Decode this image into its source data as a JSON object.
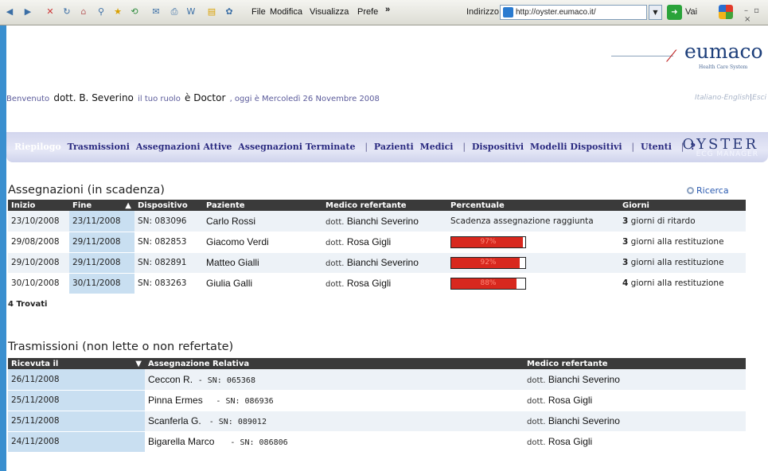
{
  "browser": {
    "menu": [
      "File",
      "Modifica",
      "Visualizza",
      "Prefe"
    ],
    "overflow": "»",
    "address_label": "Indirizzo",
    "url": "http://oyster.eumaco.it/",
    "go_label": "Vai"
  },
  "header": {
    "logo": "eumaco",
    "logo_sub": "Health Care System"
  },
  "welcome": {
    "prefix": "Benvenuto",
    "user": "dott. B. Severino",
    "role_text": "il tuo ruolo",
    "role": "è Doctor",
    "date_text": ", oggi è Mercoledì 26 Novembre 2008",
    "lang_it": "Italiano",
    "lang_sep": "-",
    "lang_en": "English",
    "pipe": "|",
    "logout": "Esci"
  },
  "nav": {
    "items": [
      "Riepilogo",
      "Trasmissioni",
      "Assegnazioni Attive",
      "Assegnazioni Terminate",
      "|",
      "Pazienti",
      "Medici",
      "|",
      "Dispositivi",
      "Modelli Dispositivi",
      "|",
      "Utenti",
      "|",
      "?"
    ],
    "brand": "OYSTER",
    "brand_sub": "ECG MANAGER"
  },
  "assegnazioni": {
    "title": "Assegnazioni (in scadenza)",
    "search": "Ricerca",
    "columns": [
      "Inizio",
      "Fine",
      "Dispositivo",
      "Paziente",
      "Medico refertante",
      "Percentuale",
      "Giorni"
    ],
    "sort_indicator": "▲",
    "rows": [
      {
        "inizio": "23/10/2008",
        "fine": "23/11/2008",
        "dispositivo": "SN: 083096",
        "paziente": "Carlo Rossi",
        "dott": "dott.",
        "medico": "Bianchi Severino",
        "percent_text": "Scadenza assegnazione raggiunta",
        "percent": null,
        "giorni_n": "3",
        "giorni": "giorni di ritardo"
      },
      {
        "inizio": "29/08/2008",
        "fine": "29/11/2008",
        "dispositivo": "SN: 082853",
        "paziente": "Giacomo Verdi",
        "dott": "dott.",
        "medico": "Rosa Gigli",
        "percent_text": "97%",
        "percent": 97,
        "giorni_n": "3",
        "giorni": "giorni alla restituzione"
      },
      {
        "inizio": "29/10/2008",
        "fine": "29/11/2008",
        "dispositivo": "SN: 082891",
        "paziente": "Matteo Gialli",
        "dott": "dott.",
        "medico": "Bianchi Severino",
        "percent_text": "92%",
        "percent": 92,
        "giorni_n": "3",
        "giorni": "giorni alla restituzione"
      },
      {
        "inizio": "30/10/2008",
        "fine": "30/11/2008",
        "dispositivo": "SN: 083263",
        "paziente": "Giulia Galli",
        "dott": "dott.",
        "medico": "Rosa Gigli",
        "percent_text": "88%",
        "percent": 88,
        "giorni_n": "4",
        "giorni": "giorni alla restituzione"
      }
    ],
    "found": "4 Trovati"
  },
  "trasmissioni": {
    "title": "Trasmissioni (non lette o non refertate)",
    "columns": [
      "Ricevuta il",
      "Assegnazione Relativa",
      "Medico refertante"
    ],
    "sort_indicator": "▼",
    "rows": [
      {
        "ricevuta": "26/11/2008",
        "paziente": "Ceccon R.",
        "sn": "- SN: 065368",
        "dott": "dott.",
        "medico": "Bianchi Severino"
      },
      {
        "ricevuta": "25/11/2008",
        "paziente": "Pinna Ermes",
        "sn": "- SN: 086936",
        "dott": "dott.",
        "medico": "Rosa Gigli"
      },
      {
        "ricevuta": "25/11/2008",
        "paziente": "Scanferla G.",
        "sn": "- SN: 089012",
        "dott": "dott.",
        "medico": "Bianchi Severino"
      },
      {
        "ricevuta": "24/11/2008",
        "paziente": "Bigarella Marco",
        "sn": "- SN: 086806",
        "dott": "dott.",
        "medico": "Rosa Gigli"
      }
    ]
  },
  "colors": {
    "accent": "#d8281e",
    "header_bg": "#3a3a3a",
    "row_alt": "#edf2f7",
    "sorted_col": "#c9dff1"
  }
}
